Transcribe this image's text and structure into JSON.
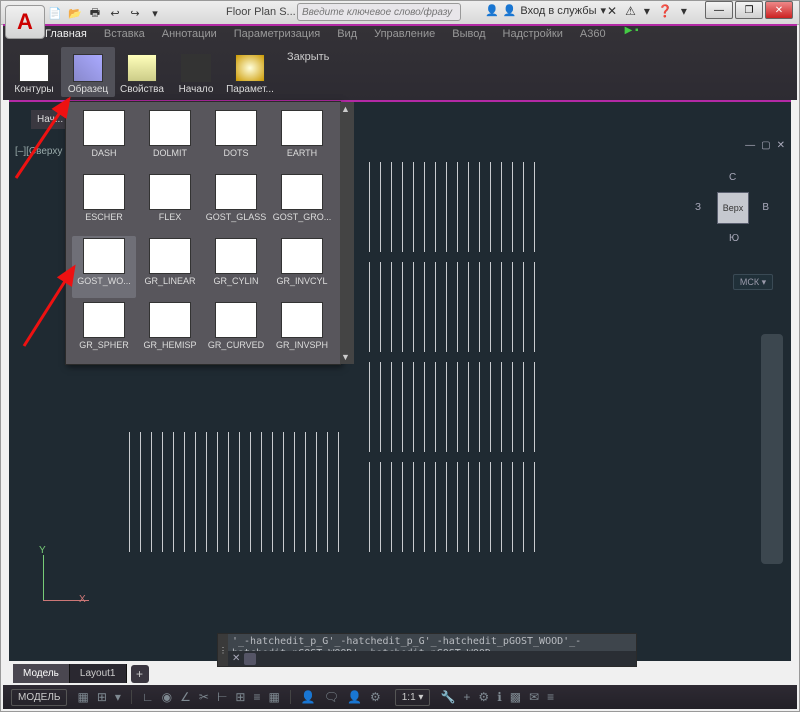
{
  "win": {
    "doc_title": "Floor Plan S...",
    "min": "—",
    "max": "❐",
    "close": "✕"
  },
  "app_icon": "A",
  "qat_icons": [
    "📄",
    "📂",
    "🖶",
    "↩",
    "↪",
    "▾"
  ],
  "search": {
    "placeholder": "Введите ключевое слово/фразу"
  },
  "signin": {
    "icon1": "👤",
    "icon2": "👤",
    "label": "Вход в службы",
    "drop": "▾"
  },
  "top_icons": [
    "✕",
    "⚠",
    "▾",
    "❓",
    "▾"
  ],
  "tabs": [
    {
      "label": "Главная"
    },
    {
      "label": "Вставка"
    },
    {
      "label": "Аннотации"
    },
    {
      "label": "Параметризация"
    },
    {
      "label": "Вид"
    },
    {
      "label": "Управление"
    },
    {
      "label": "Вывод"
    },
    {
      "label": "Надстройки"
    },
    {
      "label": "A360"
    }
  ],
  "tabs_play": "▶ ▪",
  "ribbon": [
    {
      "label": "Контуры",
      "cls": "contour"
    },
    {
      "label": "Образец",
      "cls": "pattern",
      "sel": true
    },
    {
      "label": "Свойства",
      "cls": "props"
    },
    {
      "label": "Начало",
      "cls": "orig"
    },
    {
      "label": "Парамет...",
      "cls": "param"
    }
  ],
  "close_label": "Закрыть",
  "gallery": [
    {
      "label": "DASH",
      "cls": "t-dash"
    },
    {
      "label": "DOLMIT",
      "cls": "t-dolmit"
    },
    {
      "label": "DOTS",
      "cls": "t-dots"
    },
    {
      "label": "EARTH",
      "cls": "t-earth"
    },
    {
      "label": "ESCHER",
      "cls": "t-escher"
    },
    {
      "label": "FLEX",
      "cls": "t-flex"
    },
    {
      "label": "GOST_GLASS",
      "cls": "t-glass"
    },
    {
      "label": "GOST_GRO...",
      "cls": "t-ground"
    },
    {
      "label": "GOST_WO...",
      "cls": "t-wood",
      "sel": true
    },
    {
      "label": "GR_LINEAR",
      "cls": "t-lin"
    },
    {
      "label": "GR_CYLIN",
      "cls": "t-cyl"
    },
    {
      "label": "GR_INVCYL",
      "cls": "t-invcyl"
    },
    {
      "label": "GR_SPHER",
      "cls": "t-sph"
    },
    {
      "label": "GR_HEMISP",
      "cls": "t-hem"
    },
    {
      "label": "GR_CURVED",
      "cls": "t-cur"
    },
    {
      "label": "GR_INVSPH",
      "cls": "t-invsph"
    }
  ],
  "filetab": "Нач...",
  "view_tag": "[–][Сверху",
  "view_dock": [
    "—",
    "▢",
    "✕"
  ],
  "viewcube": {
    "n": "С",
    "e": "В",
    "s": "Ю",
    "w": "З",
    "face": "Верх"
  },
  "mck": "МСК ▾",
  "axes": {
    "x": "X",
    "y": "Y"
  },
  "cmd": {
    "handle": "⋮",
    "hist": "'_-hatchedit_p_G'_-hatchedit_p_G'_-hatchedit_pGOST_WOOD'_-hatchedit_pGOST_WOOD'_-hatchedit_pGOST_WOOD",
    "x": "✕"
  },
  "b_tabs": [
    {
      "label": "Модель",
      "active": true
    },
    {
      "label": "Layout1"
    }
  ],
  "b_plus": "+",
  "status": {
    "model": "МОДЕЛЬ",
    "scale": "1:1 ▾",
    "icons_left": [
      "▦",
      "⊞",
      "▾"
    ],
    "icons_mid": [
      "∟",
      "◉",
      "∠",
      "✂",
      "⊢",
      "⊞",
      "≡",
      "▦"
    ],
    "icons_right": [
      "👤",
      "🗨",
      "👤",
      "⚙",
      "🔧",
      "+",
      "⚙",
      "ℹ",
      "▩",
      "✉",
      "≡"
    ]
  }
}
